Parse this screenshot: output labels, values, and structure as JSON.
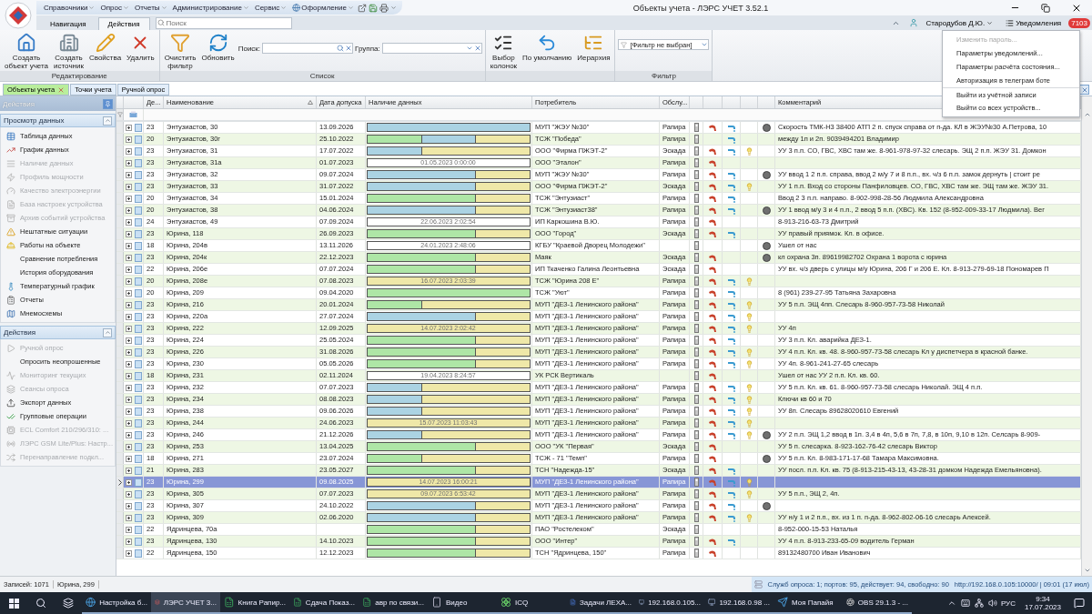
{
  "window": {
    "title": "Объекты учета - ЛЭРС УЧЕТ 3.52.1"
  },
  "menu": [
    "Справочники",
    "Опрос",
    "Отчеты",
    "Администрирование",
    "Сервис",
    "Оформление"
  ],
  "ribbon_tabs": [
    {
      "label": "Навигация",
      "selected": false
    },
    {
      "label": "Действия",
      "selected": true
    }
  ],
  "search": {
    "placeholder": "Поиск"
  },
  "user": {
    "name": "Стародубов Д.Ю.",
    "notifications": "Уведомления",
    "badge": "7103"
  },
  "user_menu": [
    {
      "label": "Изменить пароль...",
      "disabled": true,
      "group_start": false
    },
    {
      "label": "Параметры уведомлений...",
      "disabled": false,
      "group_start": false
    },
    {
      "label": "Параметры расчёта состояния...",
      "disabled": false,
      "group_start": false
    },
    {
      "label": "Авторизация в телеграм боте",
      "disabled": false,
      "group_start": false
    },
    {
      "label": "Выйти из учётной записи",
      "disabled": false,
      "group_start": true
    },
    {
      "label": "Выйти со всех устройств...",
      "disabled": false,
      "group_start": false
    }
  ],
  "ribbon": {
    "groups": [
      {
        "label": "Редактирование",
        "buttons": [
          "Создать\nобъект учета",
          "Создать\nисточник",
          "Свойства",
          "Удалить"
        ]
      },
      {
        "label": "Список",
        "buttons": [
          "Очистить\nфильтр",
          "Обновить"
        ],
        "fields": [
          "Поиск:",
          "Группа:"
        ]
      },
      {
        "buttons": [
          "Выбор\nколонок",
          "По умолчанию",
          "Иерархия"
        ]
      },
      {
        "label": "Фильтр",
        "filter": "[Фильтр не выбран]"
      }
    ]
  },
  "doc_tabs": [
    {
      "label": "Объекты учета",
      "selected": true
    },
    {
      "label": "Точки учета",
      "selected": false
    },
    {
      "label": "Ручной опрос",
      "selected": false
    }
  ],
  "sidebar": {
    "title": "Действия",
    "sections": [
      {
        "title": "Просмотр данных",
        "items": [
          {
            "label": "Таблица данных",
            "kind": "table",
            "disabled": false
          },
          {
            "label": "График данных",
            "kind": "chart",
            "disabled": false
          },
          {
            "label": "Наличие данных",
            "kind": "list",
            "disabled": true
          },
          {
            "label": "Профиль мощности",
            "kind": "power",
            "disabled": true
          },
          {
            "label": "Качество электроэнергии",
            "kind": "quality",
            "disabled": true
          },
          {
            "label": "База настроек устройства",
            "kind": "settings",
            "disabled": true
          },
          {
            "label": "Архив событий устройства",
            "kind": "archive",
            "disabled": true
          },
          {
            "label": "Нештатные ситуации",
            "kind": "warning",
            "disabled": false
          },
          {
            "label": "Работы на объекте",
            "kind": "work",
            "disabled": false
          },
          {
            "label": "Сравнение потребления",
            "kind": "plain",
            "disabled": false
          },
          {
            "label": "История оборудования",
            "kind": "plain",
            "disabled": false
          },
          {
            "label": "Температурный график",
            "kind": "temp",
            "disabled": false
          },
          {
            "label": "Отчеты",
            "kind": "report",
            "disabled": false
          },
          {
            "label": "Мнемосхемы",
            "kind": "scheme",
            "disabled": false
          }
        ]
      },
      {
        "title": "Действия",
        "items": [
          {
            "label": "Ручной опрос",
            "kind": "play",
            "disabled": true
          },
          {
            "label": "Опросить неопрошенные",
            "kind": "plain",
            "disabled": false
          },
          {
            "label": "Мониторинг текущих",
            "kind": "monitor",
            "disabled": true
          },
          {
            "label": "Сеансы опроса",
            "kind": "sessions",
            "disabled": true
          },
          {
            "label": "Экспорт данных",
            "kind": "export",
            "disabled": false
          },
          {
            "label": "Групповые операции",
            "kind": "group",
            "disabled": false
          },
          {
            "label": "ECL Comfort 210/296/310: ...",
            "kind": "device",
            "disabled": true
          },
          {
            "label": "ЛЭРС GSM Lite/Plus: Настр...",
            "kind": "modem",
            "disabled": true
          },
          {
            "label": "Перенаправление подкл...",
            "kind": "redirect",
            "disabled": true
          }
        ]
      }
    ]
  },
  "table": {
    "columns": [
      "Де...",
      "Наименование",
      "Дата допуска",
      "Наличие данных",
      "Потребитель",
      "Обслу...",
      "Комментарий"
    ],
    "rows": [
      {
        "de": "23",
        "name": "Энтузиастов, 30",
        "date": "13.09.2026",
        "bar": {
          "parts": [
            {
              "color": "#abd3e3"
            },
            {
              "color": "#abd3e3"
            },
            {
              "color": "#abd3e3"
            }
          ]
        },
        "consumer": "МУП \"ЖЭУ №30\"",
        "service": "Рапира",
        "heat": true,
        "water": true,
        "light": false,
        "marker": true,
        "comment": "Скорость ТМК-Н3 38400 АТП 2 п. спуск справа от п-да. КЛ в ЖЭУ№30 А.Петрова, 10",
        "selected": false
      },
      {
        "de": "20",
        "name": "Энтузиастов, 30г",
        "date": "25.10.2022",
        "bar": {
          "parts": [
            {
              "color": "#aee6a6"
            },
            {
              "color": "#abd3e3"
            },
            {
              "color": "#efe8a8"
            }
          ]
        },
        "consumer": "ТСЖ \"Победа\"",
        "service": "Рапира",
        "heat": false,
        "water": true,
        "light": false,
        "marker": false,
        "comment": "между 1п и 2п. 9039494201 Владимир",
        "selected": false
      },
      {
        "de": "23",
        "name": "Энтузиастов, 31",
        "date": "17.07.2022",
        "bar": {
          "parts": [
            {
              "color": "#abd3e3"
            },
            {
              "color": "#efe8a8"
            },
            {
              "color": "#efe8a8"
            }
          ]
        },
        "consumer": "ООО \"Фирма ПЖЭТ-2\"",
        "service": "Эскада",
        "heat": true,
        "water": true,
        "light": true,
        "marker": false,
        "comment": "УУ 3 п.п. СО, ГВС, ХВС там же. 8-961-978-97-32 слесарь. ЭЩ 2 п.п. ЖЭУ 31. Домкон",
        "selected": false
      },
      {
        "de": "23",
        "name": "Энтузиастов, 31а",
        "date": "01.07.2023",
        "bar": {
          "parts": [
            {
              "color": "#ffffff"
            },
            {
              "color": "#ffffff"
            },
            {
              "color": "#ffffff"
            }
          ],
          "label": "01.05.2023 0:00:00"
        },
        "consumer": "ООО \"Эталон\"",
        "service": "Рапира",
        "heat": true,
        "water": false,
        "light": false,
        "marker": false,
        "selected": false
      },
      {
        "de": "23",
        "name": "Энтузиастов, 32",
        "date": "09.07.2024",
        "bar": {
          "parts": [
            {
              "color": "#abd3e3"
            },
            {
              "color": "#abd3e3"
            },
            {
              "color": "#efe8a8"
            }
          ]
        },
        "consumer": "МУП \"ЖЭУ №30\"",
        "service": "Рапира",
        "heat": true,
        "water": true,
        "light": false,
        "marker": true,
        "comment": "УУ ввод 1 2 п.п. справа, ввод 2 м/у 7 и 8 п.п., вх. ч/з 6 п.п. замок дернуть | стоит ре",
        "selected": false
      },
      {
        "de": "23",
        "name": "Энтузиастов, 33",
        "date": "31.07.2022",
        "bar": {
          "parts": [
            {
              "color": "#abd3e3"
            },
            {
              "color": "#abd3e3"
            },
            {
              "color": "#efe8a8"
            }
          ]
        },
        "consumer": "ООО \"Фирма ПЖЭТ-2\"",
        "service": "Эскада",
        "heat": true,
        "water": true,
        "light": true,
        "marker": false,
        "comment": "УУ 1 п.п. Вход со стороны Панфиловцев. СО, ГВС, ХВС там же. ЭЩ там же. ЖЭУ 31.",
        "selected": false
      },
      {
        "de": "20",
        "name": "Энтузиастов, 34",
        "date": "15.01.2024",
        "bar": {
          "parts": [
            {
              "color": "#aee6a6"
            },
            {
              "color": "#aee6a6"
            },
            {
              "color": "#efe8a8"
            }
          ]
        },
        "consumer": "ТСЖ \"Энтузиаст\"",
        "service": "Рапира",
        "heat": true,
        "water": true,
        "light": false,
        "marker": false,
        "comment": "Ввод 2 3 п.п. направо. 8-902-998-28-56 Людмила Александровна",
        "selected": false
      },
      {
        "de": "20",
        "name": "Энтузиастов, 38",
        "date": "04.06.2024",
        "bar": {
          "parts": [
            {
              "color": "#abd3e3"
            },
            {
              "color": "#abd3e3"
            },
            {
              "color": "#efe8a8"
            }
          ]
        },
        "consumer": "ТСЖ \"Энтузиаст38\"",
        "service": "Рапира",
        "heat": true,
        "water": true,
        "light": false,
        "marker": true,
        "comment": "УУ 1 ввод м/у 3 и 4 п.п., 2 ввод 5 п.п. (ХВС). Кв. 152 (8-952-009-33-17 Людмила). Вег",
        "selected": false
      },
      {
        "de": "24",
        "name": "Энтузиастов, 49",
        "date": "07.09.2024",
        "bar": {
          "parts": [
            {
              "color": "#ffffff"
            },
            {
              "color": "#ffffff"
            },
            {
              "color": "#ffffff"
            }
          ],
          "label": "22.06.2023 2:02:54"
        },
        "consumer": "ИП Каркошина В.Ю.",
        "service": "Рапира",
        "heat": true,
        "water": false,
        "light": false,
        "marker": false,
        "comment": "8-913-216-63-73 Дмитрий",
        "selected": false
      },
      {
        "de": "23",
        "name": "Юрина, 118",
        "date": "26.09.2023",
        "bar": {
          "parts": [
            {
              "color": "#aee6a6"
            },
            {
              "color": "#aee6a6"
            },
            {
              "color": "#efe8a8"
            }
          ]
        },
        "consumer": "ООО \"Город\"",
        "service": "Эскада",
        "heat": true,
        "water": true,
        "light": false,
        "marker": false,
        "comment": "УУ правый приямок. Кл. в офисе.",
        "selected": false
      },
      {
        "de": "18",
        "name": "Юрина, 204в",
        "date": "13.11.2026",
        "bar": {
          "parts": [
            {
              "color": "#ffffff"
            },
            {
              "color": "#ffffff"
            },
            {
              "color": "#ffffff"
            }
          ],
          "label": "24.01.2023 2:48:06"
        },
        "consumer": "КГБУ \"Краевой Дворец Молодежи\"",
        "heat": false,
        "water": false,
        "light": false,
        "marker": true,
        "comment": "Ушел от нас",
        "selected": false
      },
      {
        "de": "23",
        "name": "Юрина, 204к",
        "date": "22.12.2023",
        "bar": {
          "parts": [
            {
              "color": "#aee6a6"
            },
            {
              "color": "#aee6a6"
            },
            {
              "color": "#efe8a8"
            }
          ]
        },
        "consumer": "Маяк",
        "service": "Эскада",
        "heat": true,
        "water": false,
        "light": false,
        "marker": true,
        "comment": "кл охрана 3п. 89619982702 Охрана 1 ворота с юрина",
        "selected": false
      },
      {
        "de": "22",
        "name": "Юрина, 206е",
        "date": "07.07.2024",
        "bar": {
          "parts": [
            {
              "color": "#aee6a6"
            },
            {
              "color": "#aee6a6"
            },
            {
              "color": "#efe8a8"
            }
          ]
        },
        "consumer": "ИП Ткаченко Галина Леонтьевна",
        "service": "Эскада",
        "heat": true,
        "water": false,
        "light": false,
        "marker": false,
        "comment": "УУ вх. ч/з дверь с улицы м/у Юрина, 206 Г и 206 Е. Кл. 8-913-279-69-18 Пономарев П",
        "selected": false
      },
      {
        "de": "20",
        "name": "Юрина, 208е",
        "date": "07.08.2023",
        "bar": {
          "parts": [
            {
              "color": "#efe8a8"
            },
            {
              "color": "#efe8a8"
            },
            {
              "color": "#efe8a8"
            }
          ],
          "label": "16.07.2023 2:03:39"
        },
        "consumer": "ТСЖ \"Юрина 208 Е\"",
        "service": "Рапира",
        "heat": true,
        "water": true,
        "light": true,
        "marker": false,
        "selected": false
      },
      {
        "de": "20",
        "name": "Юрина, 209",
        "date": "09.04.2020",
        "bar": {
          "parts": [
            {
              "color": "#aee6a6"
            },
            {
              "color": "#aee6a6"
            },
            {
              "color": "#aee6a6"
            }
          ]
        },
        "consumer": "ТСЖ \"Уют\"",
        "service": "Рапира",
        "heat": true,
        "water": true,
        "light": false,
        "marker": false,
        "comment": "8 (961) 239-27-95 Татьяна Захаровна",
        "selected": false
      },
      {
        "de": "23",
        "name": "Юрина, 216",
        "date": "20.01.2024",
        "bar": {
          "parts": [
            {
              "color": "#aee6a6"
            },
            {
              "color": "#efe8a8"
            },
            {
              "color": "#efe8a8"
            }
          ]
        },
        "consumer": "МУП \"ДЕЗ-1 Ленинского района\"",
        "service": "Рапира",
        "heat": true,
        "water": true,
        "light": true,
        "marker": false,
        "comment": "УУ 5 п.п. ЭЩ 4пп. Слесарь 8-960-957-73-58 Николай",
        "selected": false
      },
      {
        "de": "23",
        "name": "Юрина, 220а",
        "date": "27.07.2024",
        "bar": {
          "parts": [
            {
              "color": "#abd3e3"
            },
            {
              "color": "#abd3e3"
            },
            {
              "color": "#efe8a8"
            }
          ]
        },
        "consumer": "МУП \"ДЕЗ-1 Ленинского района\"",
        "service": "Рапира",
        "heat": true,
        "water": true,
        "light": true,
        "marker": false,
        "selected": false
      },
      {
        "de": "23",
        "name": "Юрина, 222",
        "date": "12.09.2025",
        "bar": {
          "parts": [
            {
              "color": "#efe8a8"
            },
            {
              "color": "#efe8a8"
            },
            {
              "color": "#efe8a8"
            }
          ],
          "label": "14.07.2023 2:02:42"
        },
        "consumer": "МУП \"ДЕЗ-1 Ленинского района\"",
        "service": "Рапира",
        "heat": true,
        "water": true,
        "light": true,
        "marker": false,
        "comment": "УУ 4п",
        "selected": false
      },
      {
        "de": "23",
        "name": "Юрина, 224",
        "date": "25.05.2024",
        "bar": {
          "parts": [
            {
              "color": "#aee6a6"
            },
            {
              "color": "#aee6a6"
            },
            {
              "color": "#efe8a8"
            }
          ]
        },
        "consumer": "МУП \"ДЕЗ-1 Ленинского района\"",
        "service": "Рапира",
        "heat": true,
        "water": true,
        "light": false,
        "marker": false,
        "comment": "УУ 3 п.п. Кл. аварийка ДЕЗ-1.",
        "selected": false
      },
      {
        "de": "23",
        "name": "Юрина, 226",
        "date": "31.08.2026",
        "bar": {
          "parts": [
            {
              "color": "#aee6a6"
            },
            {
              "color": "#aee6a6"
            },
            {
              "color": "#efe8a8"
            }
          ]
        },
        "consumer": "МУП \"ДЕЗ-1 Ленинского района\"",
        "service": "Рапира",
        "heat": true,
        "water": true,
        "light": true,
        "marker": false,
        "comment": "УУ 4 п.п. Кл. кв. 48. 8-960-957-73-58 слесарь Кл у диспетчера в красной банке.",
        "selected": false
      },
      {
        "de": "23",
        "name": "Юрина, 230",
        "date": "05.05.2026",
        "bar": {
          "parts": [
            {
              "color": "#aee6a6"
            },
            {
              "color": "#aee6a6"
            },
            {
              "color": "#efe8a8"
            }
          ]
        },
        "consumer": "МУП \"ДЕЗ-1 Ленинского района\"",
        "service": "Рапира",
        "heat": true,
        "water": true,
        "light": true,
        "marker": false,
        "comment": "УУ 4п. 8-961-241-27-65 слесарь",
        "selected": false
      },
      {
        "de": "18",
        "name": "Юрина, 231",
        "date": "02.11.2024",
        "bar": {
          "parts": [
            {
              "color": "#ffffff"
            },
            {
              "color": "#ffffff"
            },
            {
              "color": "#ffffff"
            }
          ],
          "label": "19.04.2023 8:24:57"
        },
        "consumer": "УК РСК Вертикаль",
        "heat": true,
        "water": false,
        "light": false,
        "marker": false,
        "comment": "Ушел от нас УУ 2 п.п. Кл. кв. 60.",
        "selected": false
      },
      {
        "de": "23",
        "name": "Юрина, 232",
        "date": "07.07.2023",
        "bar": {
          "parts": [
            {
              "color": "#abd3e3"
            },
            {
              "color": "#efe8a8"
            },
            {
              "color": "#efe8a8"
            }
          ]
        },
        "consumer": "МУП \"ДЕЗ-1 Ленинского района\"",
        "service": "Рапира",
        "heat": true,
        "water": true,
        "light": true,
        "marker": false,
        "comment": "УУ 5 п.п. Кл. кв. 61. 8-960-957-73-58 слесарь Николай. ЭЩ 4 п.п.",
        "selected": false
      },
      {
        "de": "23",
        "name": "Юрина, 234",
        "date": "08.08.2023",
        "bar": {
          "parts": [
            {
              "color": "#abd3e3"
            },
            {
              "color": "#efe8a8"
            },
            {
              "color": "#efe8a8"
            }
          ]
        },
        "consumer": "МУП \"ДЕЗ-1 Ленинского района\"",
        "service": "Рапира",
        "heat": true,
        "water": true,
        "light": true,
        "marker": false,
        "comment": "Ключи кв 60 и 70",
        "selected": false
      },
      {
        "de": "23",
        "name": "Юрина, 238",
        "date": "09.06.2026",
        "bar": {
          "parts": [
            {
              "color": "#abd3e3"
            },
            {
              "color": "#efe8a8"
            },
            {
              "color": "#efe8a8"
            }
          ]
        },
        "consumer": "МУП \"ДЕЗ-1 Ленинского района\"",
        "service": "Рапира",
        "heat": true,
        "water": true,
        "light": true,
        "marker": false,
        "comment": "УУ 8п. Слесарь 89628020610 Евгений",
        "selected": false
      },
      {
        "de": "23",
        "name": "Юрина, 244",
        "date": "24.06.2023",
        "bar": {
          "parts": [
            {
              "color": "#efe8a8"
            },
            {
              "color": "#efe8a8"
            },
            {
              "color": "#efe8a8"
            }
          ],
          "label": "15.07.2023 11:03:43"
        },
        "consumer": "МУП \"ДЕЗ-1 Ленинского района\"",
        "service": "Рапира",
        "heat": true,
        "water": true,
        "light": true,
        "marker": false,
        "selected": false
      },
      {
        "de": "23",
        "name": "Юрина, 246",
        "date": "21.12.2026",
        "bar": {
          "parts": [
            {
              "color": "#abd3e3"
            },
            {
              "color": "#efe8a8"
            },
            {
              "color": "#efe8a8"
            }
          ]
        },
        "consumer": "МУП \"ДЕЗ-1 Ленинского района\"",
        "service": "Рапира",
        "heat": true,
        "water": true,
        "light": true,
        "marker": true,
        "comment": "УУ 2 п.п. ЭЩ 1,2 ввод в 1п. 3,4 в 4п, 5,6 в 7п, 7,8, в 10п, 9,10 в 12п. Селсарь 8-909-",
        "selected": false
      },
      {
        "de": "23",
        "name": "Юрина, 253",
        "date": "13.04.2025",
        "bar": {
          "parts": [
            {
              "color": "#aee6a6"
            },
            {
              "color": "#aee6a6"
            },
            {
              "color": "#efe8a8"
            }
          ]
        },
        "consumer": "ООО \"УК \"Первая\"",
        "service": "Эскада",
        "heat": true,
        "water": false,
        "light": false,
        "marker": false,
        "comment": "УУ 5 п. слесарка.  8-923-162-76-42 слесарь Виктор",
        "selected": false
      },
      {
        "de": "18",
        "name": "Юрина, 271",
        "date": "23.07.2024",
        "bar": {
          "parts": [
            {
              "color": "#aee6a6"
            },
            {
              "color": "#efe8a8"
            },
            {
              "color": "#efe8a8"
            }
          ]
        },
        "consumer": "ТСЖ - 71 \"Темп\"",
        "service": "Рапира",
        "heat": true,
        "water": false,
        "light": false,
        "marker": true,
        "comment": "УУ 5 п.п. Кл. 8-983-171-17-68 Тамара Максимовна.",
        "selected": false
      },
      {
        "de": "21",
        "name": "Юрина, 283",
        "date": "23.05.2027",
        "bar": {
          "parts": [
            {
              "color": "#aee6a6"
            },
            {
              "color": "#aee6a6"
            },
            {
              "color": "#efe8a8"
            }
          ]
        },
        "consumer": "ТСН \"Надежда-15\"",
        "service": "Эскада",
        "heat": true,
        "water": true,
        "light": false,
        "marker": false,
        "comment": "УУ посл. п.п. Кл. кв. 75 (8-913-215-43-13, 43-28-31 домком Надежда Емельяновна).",
        "selected": false
      },
      {
        "de": "23",
        "name": "Юрина, 299",
        "date": "09.08.2025",
        "bar": {
          "parts": [
            {
              "color": "#efe8a8"
            },
            {
              "color": "#efe8a8"
            },
            {
              "color": "#efe8a8"
            }
          ],
          "label": "14.07.2023 16:00:21"
        },
        "consumer": "МУП \"ДЕЗ-1 Ленинского района\"",
        "service": "Рапира",
        "heat": true,
        "water": true,
        "light": true,
        "marker": false,
        "selected": true
      },
      {
        "de": "23",
        "name": "Юрина, 305",
        "date": "07.07.2023",
        "bar": {
          "parts": [
            {
              "color": "#efe8a8"
            },
            {
              "color": "#efe8a8"
            },
            {
              "color": "#efe8a8"
            }
          ],
          "label": "09.07.2023 6:53:42"
        },
        "consumer": "МУП \"ДЕЗ-1 Ленинского района\"",
        "service": "Рапира",
        "heat": true,
        "water": true,
        "light": true,
        "marker": false,
        "comment": "УУ 5 п.п., ЭЩ 2, 4п.",
        "selected": false
      },
      {
        "de": "23",
        "name": "Юрина, 307",
        "date": "24.10.2022",
        "bar": {
          "parts": [
            {
              "color": "#abd3e3"
            },
            {
              "color": "#abd3e3"
            },
            {
              "color": "#efe8a8"
            }
          ]
        },
        "consumer": "МУП \"ДЕЗ-1 Ленинского района\"",
        "service": "Рапира",
        "heat": true,
        "water": true,
        "light": false,
        "marker": true,
        "selected": false
      },
      {
        "de": "23",
        "name": "Юрина, 309",
        "date": "02.06.2020",
        "bar": {
          "parts": [
            {
              "color": "#abd3e3"
            },
            {
              "color": "#abd3e3"
            },
            {
              "color": "#efe8a8"
            }
          ]
        },
        "consumer": "МУП \"ДЕЗ-1 Ленинского района\"",
        "service": "Рапира",
        "heat": true,
        "water": true,
        "light": true,
        "marker": false,
        "comment": "УУ н/у 1 и 2 п.п., вх. из 1 п. п-да. 8-962-802-06-16 слесарь Алексей.",
        "selected": false
      },
      {
        "de": "22",
        "name": "Ядринцева, 70а",
        "bar": {
          "parts": [
            {
              "color": "#aee6a6"
            },
            {
              "color": "#aee6a6"
            },
            {
              "color": "#efe8a8"
            }
          ]
        },
        "consumer": "ПАО \"Ростелеком\"",
        "service": "Эскада",
        "heat": false,
        "water": false,
        "light": false,
        "marker": false,
        "comment": "8-952-000-15-53 Наталья",
        "selected": false
      },
      {
        "de": "23",
        "name": "Ядринцева, 130",
        "date": "14.10.2023",
        "bar": {
          "parts": [
            {
              "color": "#aee6a6"
            },
            {
              "color": "#aee6a6"
            },
            {
              "color": "#efe8a8"
            }
          ]
        },
        "consumer": "ООО \"Интер\"",
        "service": "Рапира",
        "heat": true,
        "water": true,
        "light": false,
        "marker": false,
        "comment": "УУ 4 п.п. 8-913-233-65-09 водитель Герман",
        "selected": false
      },
      {
        "de": "22",
        "name": "Ядринцева, 150",
        "date": "12.12.2023",
        "bar": {
          "parts": [
            {
              "color": "#aee6a6"
            },
            {
              "color": "#aee6a6"
            },
            {
              "color": "#efe8a8"
            }
          ]
        },
        "consumer": "ТСН \"Ядринцева, 150\"",
        "service": "Рапира",
        "heat": true,
        "water": false,
        "light": false,
        "marker": false,
        "comment": "89132480700 Иван Иванович",
        "selected": false
      }
    ]
  },
  "status_bar": {
    "records": "Записей: 1071",
    "current": "Юрина, 299",
    "services": "Служб опроса: 1; портов: 95, действует: 94, свободно: 90",
    "server": "http://192.168.0.105:10000/ | 09:01 (17 июл)"
  },
  "taskbar": {
    "apps": [
      {
        "label": "Настройка б...",
        "selected": false
      },
      {
        "label": "ЛЭРС УЧЕТ 3...",
        "selected": true
      },
      {
        "label": "Книга Рапир...",
        "selected": false
      },
      {
        "label": "Сдача Показ...",
        "selected": false
      },
      {
        "label": "авр по связи...",
        "selected": false
      },
      {
        "label": "Видео",
        "selected": false
      },
      {
        "label": "ICQ",
        "selected": false
      },
      {
        "label": "Задачи ЛЕХА...",
        "selected": false
      },
      {
        "label": "192.168.0.105...",
        "selected": false
      },
      {
        "label": "192.168.0.98 ...",
        "selected": false
      },
      {
        "label": "Моя Папайя",
        "selected": false
      },
      {
        "label": "OBS 29.1.3 - ...",
        "selected": false
      }
    ],
    "language": "РУС",
    "time": "9:34",
    "date": "17.07.2023"
  }
}
